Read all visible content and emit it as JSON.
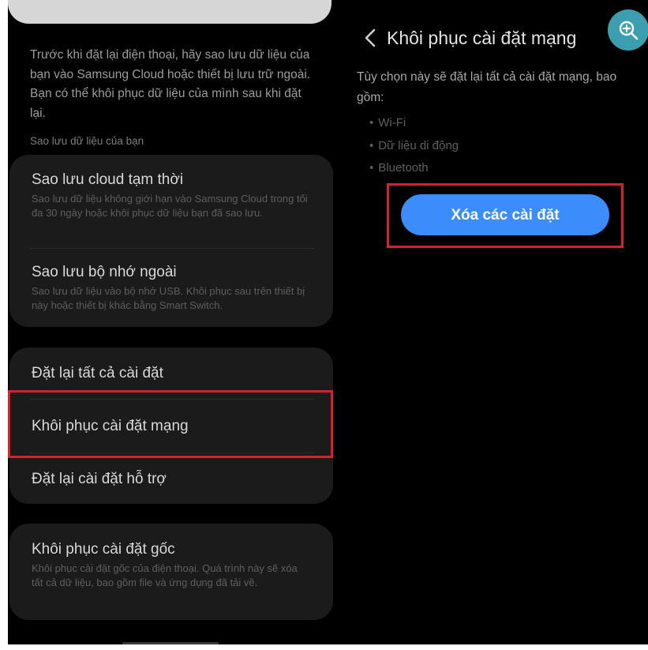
{
  "left_panel": {
    "intro_text": "Trước khi đặt lại điện thoại, hãy sao lưu dữ liệu của bạn vào Samsung Cloud hoặc thiết bị lưu trữ ngoài. Bạn có thể khôi phục dữ liệu của mình sau khi đặt lại.",
    "backup_section_label": "Sao lưu dữ liệu của bạn",
    "backup_items": [
      {
        "title": "Sao lưu cloud tạm thời",
        "subtitle": "Sao lưu dữ liệu không giới hạn vào Samsung Cloud trong tối đa 30 ngày hoặc khôi phục dữ liệu bạn đã sao lưu."
      },
      {
        "title": "Sao lưu bộ nhớ ngoài",
        "subtitle": "Sao lưu dữ liệu vào bộ nhớ USB. Khôi phục sau trên thiết bị này hoặc thiết bị khác bằng Smart Switch."
      }
    ],
    "reset_items": [
      {
        "title": "Đặt lại tất cả cài đặt"
      },
      {
        "title": "Khôi phục cài đặt mạng"
      },
      {
        "title": "Đặt lại cài đặt hỗ trợ"
      }
    ],
    "factory_reset": {
      "title": "Khôi phục cài đặt gốc",
      "subtitle": "Khôi phục cài đặt gốc của điện thoại. Quá trình này sẽ xóa tất cả dữ liệu, bao gồm file và ứng dụng đã tải về."
    }
  },
  "right_panel": {
    "back_icon": "chevron-left-icon",
    "title": "Khôi phục cài đặt mạng",
    "description": "Tùy chọn này sẽ đặt lại tất cả cài đặt mạng, bao gồm:",
    "bullets": [
      "Wi-Fi",
      "Dữ liệu di động",
      "Bluetooth"
    ],
    "reset_button_label": "Xóa các cài đặt"
  },
  "overlay": {
    "zoom_icon": "zoom-in-icon"
  },
  "colors": {
    "background": "#000000",
    "card": "#1b1b1b",
    "highlight": "#d6222e",
    "accent_button": "#3a8dfa",
    "zoom_badge": "#3c9fb0"
  }
}
